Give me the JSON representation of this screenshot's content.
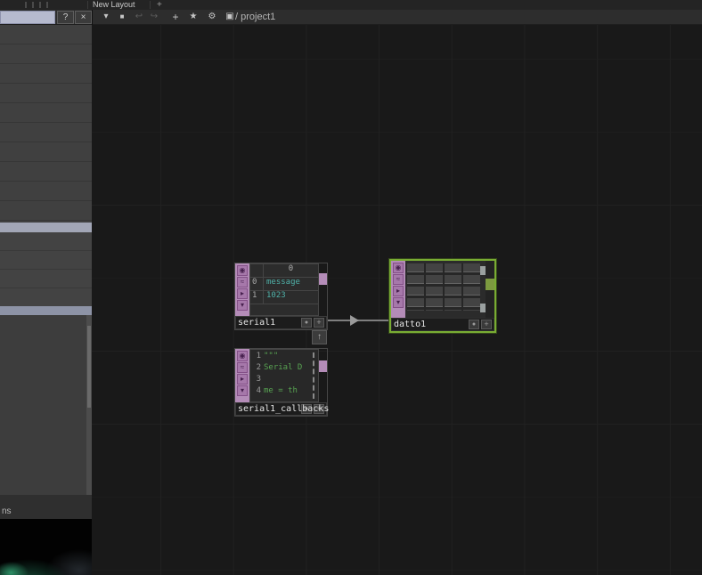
{
  "colors": {
    "dat_pink": "#b48cb8",
    "select_green": "#79ac33",
    "value_teal": "#4fb0a8",
    "code_green": "#58a352"
  },
  "layout_bar": {
    "tab": "New Layout",
    "add": "+"
  },
  "pane_header": {
    "help": "?",
    "close": "×"
  },
  "toolbar": {
    "dropdown_icon": "▾",
    "stop_icon": "■",
    "back_icon": "↩",
    "forward_icon": "↪",
    "add_icon": "+",
    "star_icon": "★",
    "options_icon": "⚙",
    "display_icon": "▣",
    "breadcrumb": "/ project1"
  },
  "sidebar": {
    "status_text": "ns"
  },
  "network": {
    "flag_icons": [
      "◉",
      "≈",
      "▸",
      "▾"
    ],
    "expand_arrow": "↑",
    "mini_viewer": "●",
    "mini_add": "+",
    "nodes": {
      "serial1": {
        "label": "serial1",
        "table": {
          "header": "0",
          "rows": [
            {
              "index": "0",
              "value": "message"
            },
            {
              "index": "1",
              "value": "1023"
            }
          ]
        }
      },
      "datto1": {
        "label": "datto1"
      },
      "serial1_callbacks": {
        "label": "serial1_callbacks",
        "code_lines": [
          {
            "num": "1",
            "text": "\"\"\""
          },
          {
            "num": "2",
            "text": "Serial D"
          },
          {
            "num": "3",
            "text": ""
          },
          {
            "num": "4",
            "text": "me = th"
          }
        ]
      }
    }
  }
}
